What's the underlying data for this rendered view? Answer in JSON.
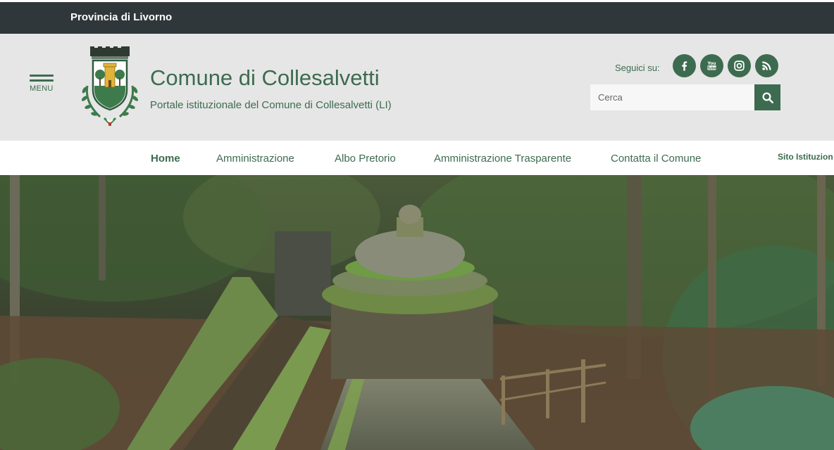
{
  "top_bar": {
    "region": "Provincia di Livorno"
  },
  "header": {
    "menu_label": "MENU",
    "title": "Comune di Collesalvetti",
    "subtitle": "Portale istituzionale del Comune di Collesalvetti (LI)",
    "follow_label": "Seguici su:",
    "social": [
      "facebook-icon",
      "youtube-icon",
      "instagram-icon",
      "rss-icon"
    ],
    "search_placeholder": "Cerca"
  },
  "nav": {
    "items": [
      {
        "label": "Home",
        "active": true
      },
      {
        "label": "Amministrazione",
        "active": false
      },
      {
        "label": "Albo Pretorio",
        "active": false
      },
      {
        "label": "Amministrazione Trasparente",
        "active": false
      },
      {
        "label": "Contatta il Comune",
        "active": false
      }
    ],
    "site_label": "Sito Istituzion"
  },
  "colors": {
    "brand_green": "#3d6b4f",
    "top_bar": "#30373b",
    "header_bg": "#e6e6e6"
  }
}
